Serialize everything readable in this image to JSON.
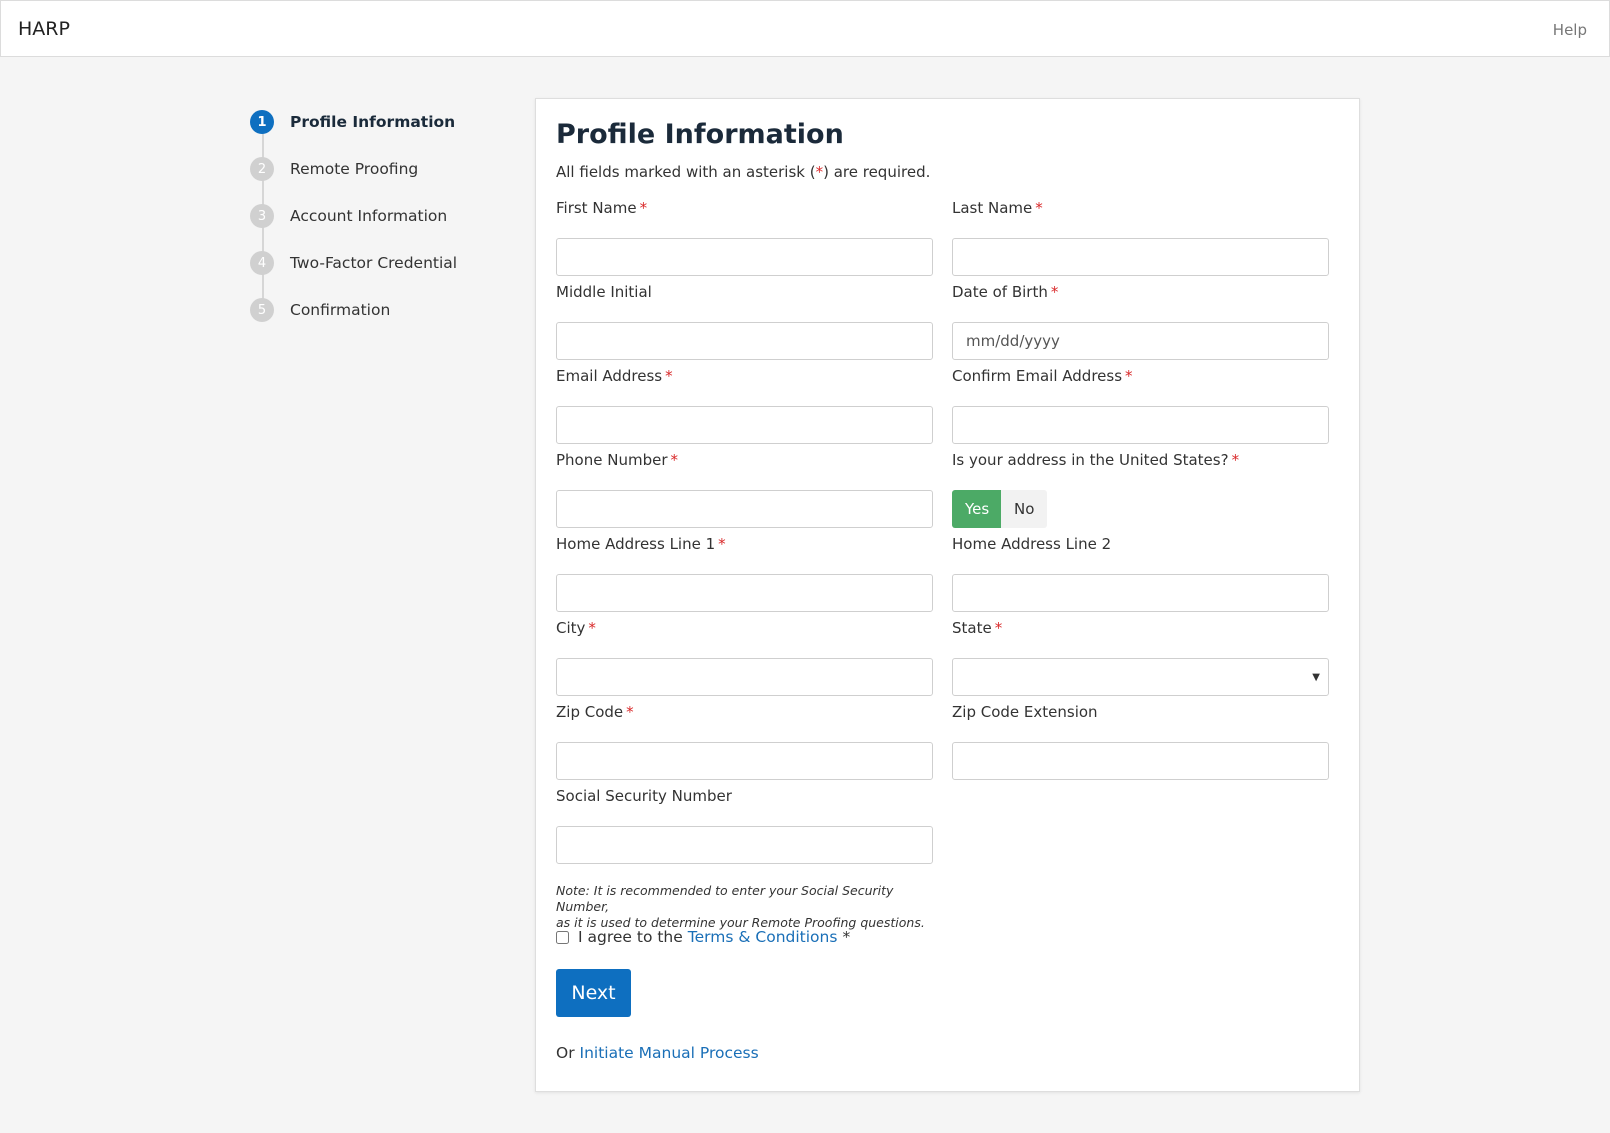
{
  "header": {
    "brand": "HARP",
    "help": "Help"
  },
  "stepper": {
    "steps": [
      {
        "number": "1",
        "label": "Profile Information"
      },
      {
        "number": "2",
        "label": "Remote Proofing"
      },
      {
        "number": "3",
        "label": "Account Information"
      },
      {
        "number": "4",
        "label": "Two-Factor Credential"
      },
      {
        "number": "5",
        "label": "Confirmation"
      }
    ]
  },
  "form": {
    "title": "Profile Information",
    "required_note_pre": "All fields marked with an asterisk (",
    "required_note_star": "*",
    "required_note_post": ") are required.",
    "required_marker": "*",
    "fields": {
      "first_name": {
        "label": "First Name",
        "value": "",
        "placeholder": ""
      },
      "last_name": {
        "label": "Last Name",
        "value": "",
        "placeholder": ""
      },
      "middle_initial": {
        "label": "Middle Initial",
        "value": "",
        "placeholder": ""
      },
      "date_of_birth": {
        "label": "Date of Birth",
        "value": "",
        "placeholder": "mm/dd/yyyy"
      },
      "email": {
        "label": "Email Address",
        "value": "",
        "placeholder": ""
      },
      "confirm_email": {
        "label": "Confirm Email Address",
        "value": "",
        "placeholder": ""
      },
      "phone": {
        "label": "Phone Number",
        "value": "",
        "placeholder": ""
      },
      "us_address": {
        "label": "Is your address in the United States?",
        "yes": "Yes",
        "no": "No",
        "selected": "Yes"
      },
      "address1": {
        "label": "Home Address Line 1",
        "value": "",
        "placeholder": ""
      },
      "address2": {
        "label": "Home Address Line 2",
        "value": "",
        "placeholder": ""
      },
      "city": {
        "label": "City",
        "value": "",
        "placeholder": ""
      },
      "state": {
        "label": "State",
        "value": ""
      },
      "zip": {
        "label": "Zip Code",
        "value": "",
        "placeholder": ""
      },
      "zip_ext": {
        "label": "Zip Code Extension",
        "value": "",
        "placeholder": ""
      },
      "ssn": {
        "label": "Social Security Number",
        "value": "",
        "placeholder": ""
      }
    },
    "ssn_note_line1": "Note: It is recommended to enter your Social Security Number,",
    "ssn_note_line2": "as it is used to determine your Remote Proofing questions.",
    "agree_prefix": "I agree to the",
    "agree_link": "Terms & Conditions",
    "agree_star": "*",
    "next_label": "Next",
    "manual_prefix": "Or",
    "manual_link": "Initiate Manual Process"
  },
  "colors": {
    "primary": "#0e6fc0",
    "toggle_active": "#4caa66",
    "required": "#d9292a",
    "link": "#1a6fb7"
  }
}
